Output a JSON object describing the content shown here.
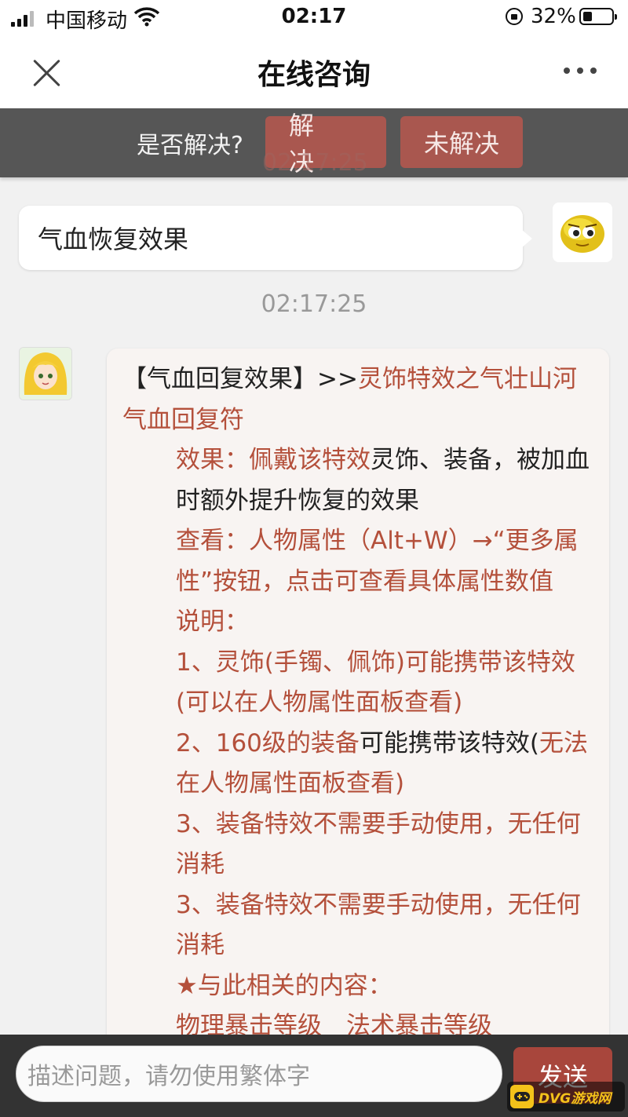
{
  "status_bar": {
    "carrier": "中国移动",
    "time": "02:17",
    "battery_percent": "32%",
    "battery_level": 0.32
  },
  "nav": {
    "title": "在线咨询"
  },
  "resolve": {
    "question": "是否解决?",
    "yes_label": "解决",
    "no_label": "未解决",
    "ghost_time": "02:17:25"
  },
  "messages": {
    "user_text": "气血恢复效果",
    "timestamp": "02:17:25",
    "bot_lines": {
      "l1a": "【气血回复效果】>>",
      "l1b": "灵饰特效之气壮山河　气血回复符",
      "l2a": "效果：佩戴该特效",
      "l2b": "灵饰、装备，被加血时额外提升恢复的效果",
      "l3": "查看：人物属性（Alt+W）→“更多属性”",
      "l3b": "按钮，点击可查看具体属性数值",
      "l4": "说明：",
      "l5": "1、灵饰(手镯、佩饰)可能携带该特效(可以在人物属性面板查看)",
      "l6a": "2、160级的装备",
      "l6b": "可能携带该特效",
      "l6c": "(",
      "l6d": "无法在人物属性面板查看)",
      "l7": "3、装备特效不需要手动使用，无任何消耗",
      "l8": "3、装备特效不需要手动使用，无任何消耗",
      "l9": "★与此相关的内容：",
      "l10": "物理暴击等级　法术暴击等级"
    }
  },
  "input": {
    "placeholder": "描述问题，请勿使用繁体字",
    "send_label": "发送"
  },
  "watermark": {
    "text": "DVG游戏网"
  }
}
